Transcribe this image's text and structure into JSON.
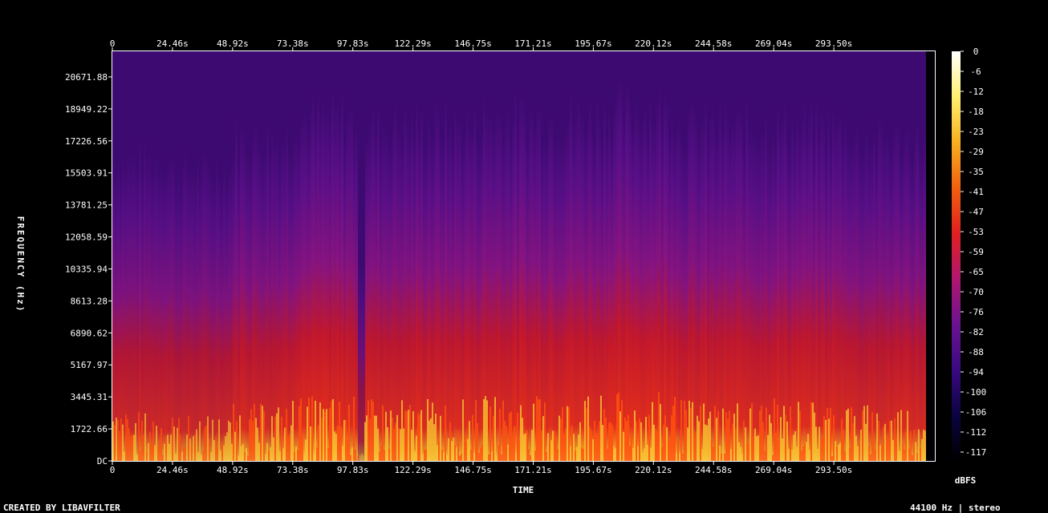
{
  "chart_data": {
    "type": "heatmap",
    "title": "",
    "xlabel": "TIME",
    "ylabel": "FREQUENCY (Hz)",
    "colorbar_label": "dBFS",
    "x_ticks": [
      "0",
      "24.46s",
      "48.92s",
      "73.38s",
      "97.83s",
      "122.29s",
      "146.75s",
      "171.21s",
      "195.67s",
      "220.12s",
      "244.58s",
      "269.04s",
      "293.50s"
    ],
    "x_tick_values": [
      0,
      24.46,
      48.92,
      73.38,
      97.83,
      122.29,
      146.75,
      171.21,
      195.67,
      220.12,
      244.58,
      269.04,
      293.5
    ],
    "xlim": [
      0,
      334.6
    ],
    "y_ticks": [
      "DC",
      "1722.66",
      "3445.31",
      "5167.97",
      "6890.62",
      "8613.28",
      "10335.94",
      "12058.59",
      "13781.25",
      "15503.91",
      "17226.56",
      "18949.22",
      "20671.88"
    ],
    "y_tick_values": [
      0,
      1722.66,
      3445.31,
      5167.97,
      6890.62,
      8613.28,
      10335.94,
      12058.59,
      13781.25,
      15503.91,
      17226.56,
      18949.22,
      20671.88
    ],
    "ylim": [
      0,
      22050
    ],
    "colorbar_ticks": [
      "0",
      "-6",
      "-12",
      "-18",
      "-23",
      "-29",
      "-35",
      "-41",
      "-47",
      "-53",
      "-59",
      "-65",
      "-70",
      "-76",
      "-82",
      "-88",
      "-94",
      "-100",
      "-106",
      "-112",
      "-117"
    ],
    "colorbar_range": [
      -120,
      0
    ],
    "colormap_stops": [
      "#000000",
      "#0a0340",
      "#3a0a80",
      "#6a1390",
      "#b0176e",
      "#e02020",
      "#f06010",
      "#f8b020",
      "#fff070",
      "#ffffff"
    ],
    "background_level_db": -88,
    "loud_segments_s": [
      {
        "start": 0,
        "end": 24,
        "level_db": -60
      },
      {
        "start": 24,
        "end": 48,
        "level_db": -62
      },
      {
        "start": 48,
        "end": 73,
        "level_db": -55
      },
      {
        "start": 73,
        "end": 99,
        "level_db": -50
      },
      {
        "start": 99,
        "end": 102,
        "level_db": -85
      },
      {
        "start": 102,
        "end": 150,
        "level_db": -52
      },
      {
        "start": 150,
        "end": 200,
        "level_db": -50
      },
      {
        "start": 200,
        "end": 230,
        "level_db": -48
      },
      {
        "start": 230,
        "end": 300,
        "level_db": -52
      },
      {
        "start": 300,
        "end": 331,
        "level_db": -55
      }
    ]
  },
  "footer": {
    "created_by": "CREATED BY LIBAVFILTER",
    "info": "44100 Hz | stereo"
  }
}
